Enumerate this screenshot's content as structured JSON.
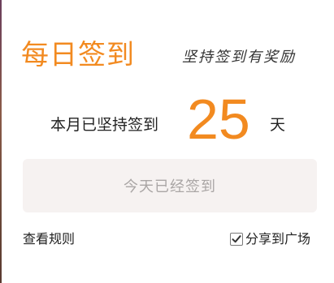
{
  "dialog": {
    "title": "每日签到",
    "slogan": "坚持签到有奖励"
  },
  "streak": {
    "prefix": "本月已坚持签到",
    "count": "25",
    "unit": "天"
  },
  "checkin_button": {
    "label": "今天已经签到",
    "state": "disabled"
  },
  "footer": {
    "rules_link": "查看规则",
    "share_label": "分享到广场",
    "share_checked": true
  },
  "colors": {
    "accent": "#f28a20",
    "button_bg": "#f6f2f1",
    "button_text": "#aaa6a5",
    "text": "#222222"
  },
  "icons": {
    "share_checkbox": "checkmark-icon"
  }
}
